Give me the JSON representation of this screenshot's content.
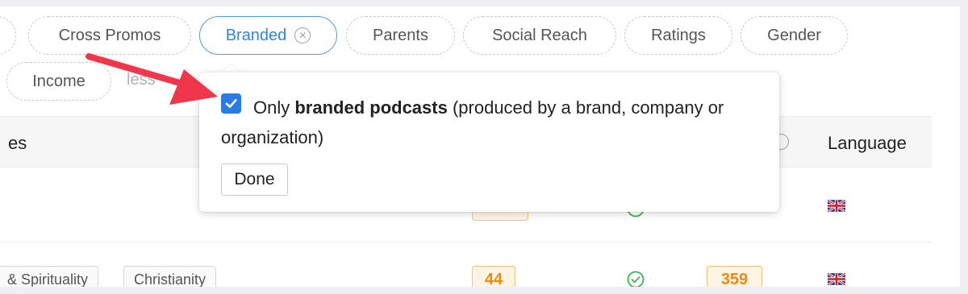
{
  "filters": {
    "chips": [
      {
        "label": "Cross Promos"
      },
      {
        "label": "Branded",
        "active": true
      },
      {
        "label": "Parents"
      },
      {
        "label": "Social Reach"
      },
      {
        "label": "Ratings"
      },
      {
        "label": "Gender"
      }
    ],
    "row2": {
      "income": "Income",
      "less": "less"
    }
  },
  "table": {
    "header": {
      "topics_partial": "es",
      "language": "Language"
    },
    "row2": {
      "tags": [
        "& Spirituality",
        "Christianity"
      ],
      "badge_a": "44",
      "badge_b": "359"
    }
  },
  "popover": {
    "checked": true,
    "text_prefix": "Only ",
    "text_bold": "branded podcasts",
    "text_suffix": " (produced by a brand, company or organization)",
    "done_label": "Done"
  },
  "colors": {
    "accent": "#2b7be4",
    "active_chip": "#4a9de6",
    "badge_orange": "#ee8a12",
    "arrow_red": "#f0364a",
    "check_green": "#3bb54a"
  }
}
